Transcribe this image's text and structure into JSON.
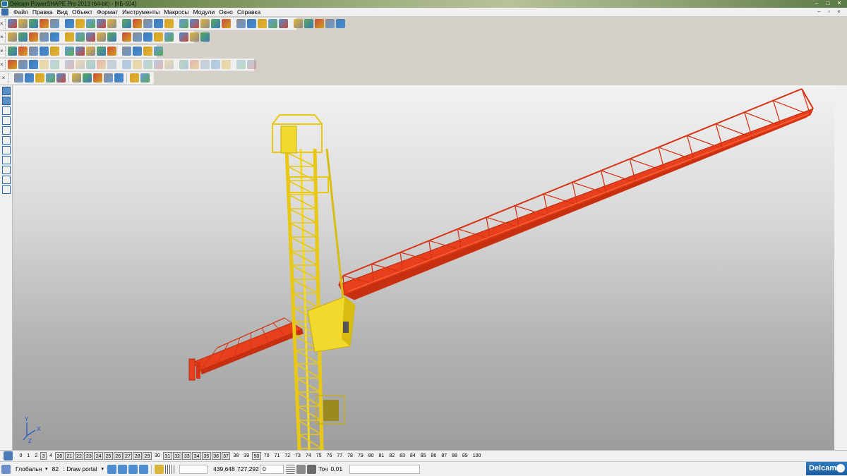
{
  "window": {
    "title": "Delcam PowerSHAPE Pro 2013 (64-bit) - [КБ-504]",
    "controls": [
      "–",
      "□",
      "✕"
    ]
  },
  "menu": {
    "items": [
      "Файл",
      "Правка",
      "Вид",
      "Объект",
      "Формат",
      "Инструменты",
      "Макросы",
      "Модули",
      "Окно",
      "Справка"
    ],
    "mdi_controls": [
      "–",
      "▫",
      "×"
    ]
  },
  "toolbars": {
    "row1_icons": [
      "new-file-icon",
      "open-icon",
      "save-icon",
      "print-icon",
      "cut-icon",
      "copy-icon",
      "paste-icon",
      "delete-icon",
      "undo-icon",
      "redo-icon",
      "select-icon",
      "circle-icon",
      "arc-icon",
      "text-icon",
      "measure-icon",
      "wireframe-icon"
    ],
    "row2_icons": [
      "shaded-cube-icon",
      "view-top-icon",
      "view-front-icon",
      "view-iso-icon",
      "zoom-in-icon",
      "zoom-out-icon",
      "zoom-fit-icon",
      "globe-icon",
      "material-icon",
      "light-icon",
      "hand-icon"
    ],
    "row3_icons": [
      "level-icon",
      "sheet-icon",
      "surface-icon",
      "solid-icon",
      "color-icon",
      "arrow-right-icon",
      "triangle-icon",
      "box-icon",
      "layer-icon",
      "grid-icon",
      "render-icon"
    ],
    "row4_icons": [
      "solid-feature-icon",
      "boolean-add-icon",
      "boolean-subtract-icon",
      "fillet-icon",
      "chamfer-icon",
      "shell-icon",
      "extrude-icon",
      "revolve-icon",
      "cut-icon",
      "hole-icon"
    ],
    "row5_icons": [
      "shape-icon",
      "axis-icon",
      "cube-icon",
      "drill-icon",
      "assembly-icon",
      "pattern-icon",
      "mirror-icon",
      "scale-icon",
      "bend-icon"
    ]
  },
  "left_tools": [
    "select-arrow-icon",
    "snap-icon",
    "line-icon",
    "polyline-icon",
    "rectangle-icon",
    "circle-icon",
    "polygon-icon",
    "cube-icon",
    "i-beam-icon",
    "curve-icon",
    "angle-icon"
  ],
  "levels": [
    {
      "label": "0",
      "boxed": false
    },
    {
      "label": "1",
      "boxed": false
    },
    {
      "label": "2",
      "boxed": false
    },
    {
      "label": "3",
      "boxed": true
    },
    {
      "label": "4",
      "boxed": false
    },
    {
      "label": "20",
      "boxed": true
    },
    {
      "label": "21",
      "boxed": true
    },
    {
      "label": "22",
      "boxed": true
    },
    {
      "label": "23",
      "boxed": true
    },
    {
      "label": "24",
      "boxed": true
    },
    {
      "label": "25",
      "boxed": true
    },
    {
      "label": "26",
      "boxed": true
    },
    {
      "label": "27",
      "boxed": true
    },
    {
      "label": "28",
      "boxed": true
    },
    {
      "label": "29",
      "boxed": true
    },
    {
      "label": "30",
      "boxed": false
    },
    {
      "label": "31",
      "boxed": true
    },
    {
      "label": "32",
      "boxed": true
    },
    {
      "label": "33",
      "boxed": true
    },
    {
      "label": "34",
      "boxed": true
    },
    {
      "label": "35",
      "boxed": true
    },
    {
      "label": "36",
      "boxed": true
    },
    {
      "label": "37",
      "boxed": true
    },
    {
      "label": "38",
      "boxed": false
    },
    {
      "label": "39",
      "boxed": false
    },
    {
      "label": "50",
      "boxed": true
    },
    {
      "label": "70",
      "boxed": false
    },
    {
      "label": "71",
      "boxed": false
    },
    {
      "label": "72",
      "boxed": false
    },
    {
      "label": "73",
      "boxed": false
    },
    {
      "label": "74",
      "boxed": false
    },
    {
      "label": "75",
      "boxed": false
    },
    {
      "label": "76",
      "boxed": false
    },
    {
      "label": "77",
      "boxed": false
    },
    {
      "label": "78",
      "boxed": false
    },
    {
      "label": "79",
      "boxed": false
    },
    {
      "label": "80",
      "boxed": false
    },
    {
      "label": "81",
      "boxed": false
    },
    {
      "label": "82",
      "boxed": false
    },
    {
      "label": "83",
      "boxed": false
    },
    {
      "label": "84",
      "boxed": false
    },
    {
      "label": "85",
      "boxed": false
    },
    {
      "label": "86",
      "boxed": false
    },
    {
      "label": "87",
      "boxed": false
    },
    {
      "label": "88",
      "boxed": false
    },
    {
      "label": "89",
      "boxed": false
    },
    {
      "label": "100",
      "boxed": false
    }
  ],
  "status": {
    "workplane": "Глобальн",
    "level_number": "82",
    "level_name": ": Draw portal",
    "coord_x": "439,648",
    "coord_y": "727,292",
    "coord_z": "0",
    "tolerance_label": "Точ",
    "tolerance_value": "0,01"
  },
  "axis_triad": {
    "x": "X",
    "y": "Y",
    "z": "Z"
  },
  "brand": "Delcam",
  "colors": {
    "tower": "#f2d92b",
    "boom": "#e8401c",
    "viewport_top": "#f2f2f2",
    "viewport_bottom": "#9d9d9d",
    "accent": "#2f7cc4"
  }
}
